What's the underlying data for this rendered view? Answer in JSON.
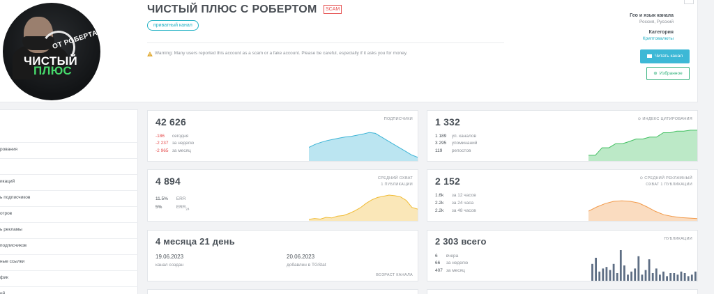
{
  "header": {
    "title": "ЧИСТЫЙ ПЛЮС С РОБЕРТОМ",
    "scam_badge": "SCAM",
    "private_label": "приватный канал",
    "warning": "Warning: Many users reported this account as a scam or a fake account. Please be careful, especially if it asks you for money.",
    "geo_label": "Гео и язык канала",
    "geo_value": "Россия, Русский",
    "category_label": "Категория",
    "category_value": "Криптовалюты",
    "read_button": "Читать канал",
    "favorite_button": "Избранное"
  },
  "avatar": {
    "logo_top": "ОТ РОБЕРТА",
    "logo_line1": "ЧИСТЫЙ",
    "logo_line2": "ПЛЮС"
  },
  "sidebar": {
    "items": [
      "",
      "рования",
      "",
      "икаций",
      "ь подписчиков",
      "отров",
      "ь рекламы",
      "подписчиков",
      "ные ссылки",
      "фик",
      "ий"
    ]
  },
  "cards": {
    "subscribers": {
      "value": "42 626",
      "caption": "ПОДПИСЧИКИ",
      "rows": [
        {
          "v": "-186",
          "l": "сегодня"
        },
        {
          "v": "-2 237",
          "l": "за неделю"
        },
        {
          "v": "-2 965",
          "l": "за месяц"
        }
      ]
    },
    "citation": {
      "value": "1 332",
      "caption": "ИНДЕКС ЦИТИРОВАНИЯ",
      "rows": [
        {
          "v": "1 189",
          "l": "уп. каналов"
        },
        {
          "v": "3 295",
          "l": "упоминаний"
        },
        {
          "v": "119",
          "l": "репостов"
        }
      ]
    },
    "reach": {
      "value": "4 894",
      "caption1": "СРЕДНИЙ ОХВАТ",
      "caption2": "1 ПУБЛИКАЦИИ",
      "rows": [
        {
          "v": "11.5%",
          "l": "ERR"
        },
        {
          "v": "5%",
          "l": "ERR",
          "sub": "24"
        }
      ]
    },
    "ad_reach": {
      "value": "2 152",
      "caption1": "СРЕДНИЙ РЕКЛАМНЫЙ",
      "caption2": "ОХВАТ 1 ПУБЛИКАЦИИ",
      "rows": [
        {
          "v": "1.6k",
          "l": "за 12 часов"
        },
        {
          "v": "2.2k",
          "l": "за 24 часа"
        },
        {
          "v": "2.2k",
          "l": "за 48 часов"
        }
      ]
    },
    "age": {
      "value": "4 месяца 21 день",
      "created_date": "19.06.2023",
      "created_label": "канал создан",
      "added_date": "20.06.2023",
      "added_label": "добавлен в TGStat",
      "caption": "ВОЗРАСТ КАНАЛА"
    },
    "posts": {
      "value": "2 303 всего",
      "caption": "ПУБЛИКАЦИИ",
      "rows": [
        {
          "v": "6",
          "l": "вчера"
        },
        {
          "v": "66",
          "l": "за неделю"
        },
        {
          "v": "407",
          "l": "за месяц"
        }
      ]
    }
  },
  "colors": {
    "subscribers_line": "#3cb4d6",
    "citation_line": "#3fbf5f",
    "reach_line": "#f0bb33",
    "ad_reach_line": "#f29a4a",
    "posts_bars": "#5e6e84",
    "negative": "#e54b4b",
    "accent": "#1fb0c4"
  },
  "chart_data": [
    {
      "type": "area",
      "name": "subscribers-sparkline",
      "values": [
        0.45,
        0.55,
        0.62,
        0.68,
        0.72,
        0.76,
        0.8,
        0.82,
        0.86,
        0.9,
        0.95,
        0.92,
        0.8,
        0.68,
        0.56,
        0.44,
        0.32,
        0.2,
        0.12
      ],
      "color": "#3cb4d6"
    },
    {
      "type": "area",
      "name": "citation-sparkline",
      "values": [
        0.18,
        0.18,
        0.42,
        0.42,
        0.55,
        0.55,
        0.62,
        0.7,
        0.7,
        0.76,
        0.76,
        0.9,
        0.9,
        0.95,
        0.95,
        0.98,
        0.98
      ],
      "color": "#3fbf5f"
    },
    {
      "type": "area",
      "name": "reach-sparkline",
      "values": [
        0.05,
        0.08,
        0.06,
        0.12,
        0.1,
        0.16,
        0.18,
        0.25,
        0.34,
        0.45,
        0.6,
        0.72,
        0.8,
        0.84,
        0.88,
        0.86,
        0.82,
        0.7,
        0.46,
        0.4
      ],
      "color": "#f0bb33"
    },
    {
      "type": "area",
      "name": "ad-reach-sparkline",
      "values": [
        0.35,
        0.5,
        0.62,
        0.7,
        0.72,
        0.7,
        0.64,
        0.5,
        0.34,
        0.22,
        0.16,
        0.12,
        0.1,
        0.08
      ],
      "color": "#f29a4a"
    },
    {
      "type": "bar",
      "name": "posts-sparkline",
      "values": [
        0.55,
        0.75,
        0.3,
        0.4,
        0.45,
        0.35,
        0.55,
        0.25,
        1.0,
        0.5,
        0.2,
        0.3,
        0.4,
        0.8,
        0.2,
        0.35,
        0.7,
        0.25,
        0.4,
        0.2,
        0.3,
        0.15,
        0.25,
        0.25,
        0.2,
        0.3,
        0.25,
        0.15,
        0.2,
        0.3
      ],
      "color": "#5e6e84"
    }
  ]
}
